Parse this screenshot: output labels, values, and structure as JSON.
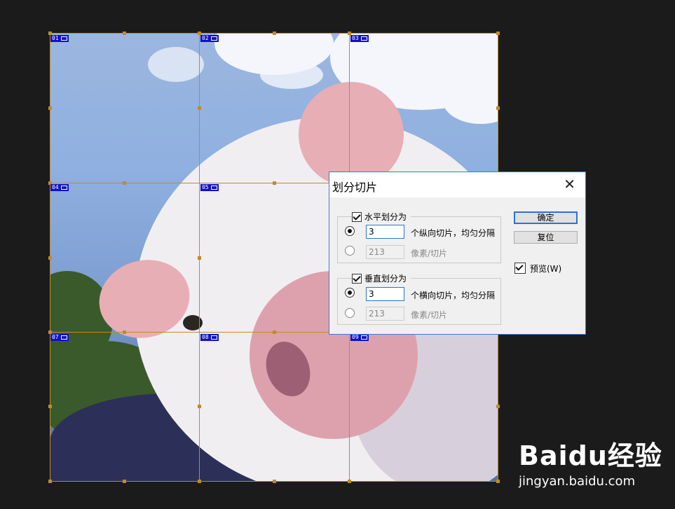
{
  "dialog": {
    "title": "划分切片",
    "close_icon": "close-icon",
    "horizontal": {
      "label": "水平划分为",
      "checked": true,
      "option1_value": "3",
      "option1_text": "个纵向切片，均匀分隔",
      "option2_value": "213",
      "option2_text": "像素/切片"
    },
    "vertical": {
      "label": "垂直划分为",
      "checked": true,
      "option1_value": "3",
      "option1_text": "个横向切片，均匀分隔",
      "option2_value": "213",
      "option2_text": "像素/切片"
    },
    "ok_label": "确定",
    "reset_label": "复位",
    "preview_label": "预览(W)",
    "preview_checked": true
  },
  "slices": [
    "01",
    "02",
    "03",
    "04",
    "05",
    "06",
    "07",
    "08",
    "09"
  ],
  "watermark": {
    "brand": "Baidu经验",
    "url": "jingyan.baidu.com"
  },
  "colors": {
    "slice_line": "#c28a26",
    "slice_tag": "#1010c8",
    "dialog_border": "#3a7bd5"
  }
}
